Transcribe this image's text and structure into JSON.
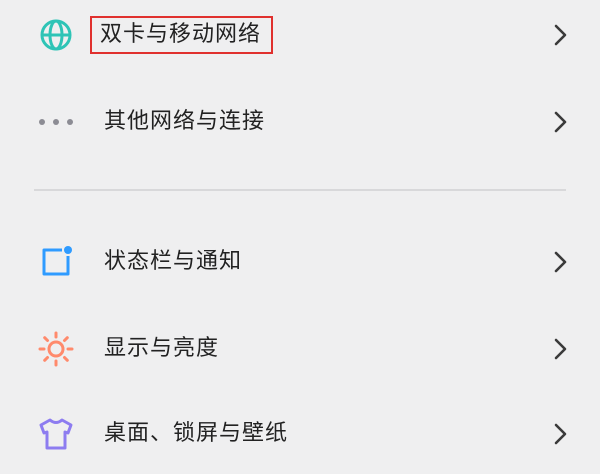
{
  "settings": {
    "items": [
      {
        "label": "双卡与移动网络",
        "icon": "globe-icon",
        "icon_color": "#2ec4b6",
        "highlighted": true
      },
      {
        "label": "其他网络与连接",
        "icon": "more-dots-icon",
        "icon_color": "#8c8c94"
      },
      {
        "label": "状态栏与通知",
        "icon": "notification-square-icon",
        "icon_color": "#2f9bff"
      },
      {
        "label": "显示与亮度",
        "icon": "sun-icon",
        "icon_color": "#ff8a6c"
      },
      {
        "label": "桌面、锁屏与壁纸",
        "icon": "shirt-icon",
        "icon_color": "#8d7cf0"
      }
    ]
  },
  "colors": {
    "background": "#efeff0",
    "highlight_border": "#e0302e",
    "text": "#222222",
    "chevron": "#3a3a3a",
    "divider": "#d8d8da"
  }
}
